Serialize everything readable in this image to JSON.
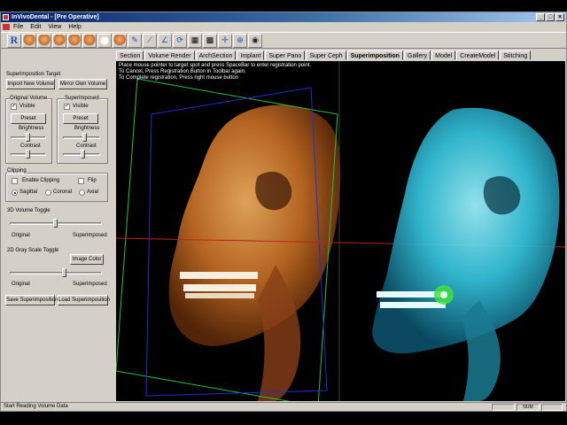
{
  "window": {
    "title": "InVivoDental - [Pre Operative]",
    "controls": {
      "minimize": "_",
      "maximize": "□",
      "close": "×"
    }
  },
  "menu": [
    "File",
    "Edit",
    "View",
    "Help"
  ],
  "toolbar": {
    "r_label": "R"
  },
  "left_panel": {
    "superimposition_target_label": "Superimposition Target",
    "import_new_volume": "Import New Volume",
    "mirror_own_volume": "Mirror Own Volume",
    "original_volume": {
      "label": "Original Volume",
      "visible_label": "Visible",
      "visible_checked": true,
      "preset": "Preset",
      "brightness": "Brightness",
      "contrast": "Contrast"
    },
    "superimposed": {
      "label": "Superimposed",
      "visible_label": "Visible",
      "visible_checked": true,
      "preset": "Preset",
      "brightness": "Brightness",
      "contrast": "Contrast"
    },
    "clipping": {
      "label": "Clipping",
      "enable_clipping": "Enable Clipping",
      "flip": "Flip",
      "sagittal": "Sagittal",
      "coronal": "Coronal",
      "axial": "Axial",
      "selected_plane": "Sagittal"
    },
    "volume_toggle": {
      "label": "3D Volume Toggle",
      "left": "Original",
      "right": "Superimposed"
    },
    "gray_toggle": {
      "label": "2D Gray Scale Toggle",
      "image_color": "Image Color",
      "left": "Original",
      "right": "Superimposed"
    },
    "save_superimposition": "Save Superimposition",
    "load_superimposition": "Load Superimposition"
  },
  "tabs": [
    "Section",
    "Volume Render",
    "ArchSection",
    "Implant",
    "Super Pano",
    "Super Ceph",
    "Superimposition",
    "Gallery",
    "Model",
    "CreateModel",
    "Stitching"
  ],
  "active_tab": "Superimposition",
  "viewport": {
    "instructions": [
      "Place mouse pointer to target spot and press SpaceBar to enter registration point.",
      "To Cancel, Press Registration Button in Toolbar again.",
      "To Complete registration, Press right mouse button"
    ]
  },
  "status": {
    "text": "Start Reading Volume Data",
    "num": "NUM"
  },
  "colors": {
    "titlebar": "#0a246a",
    "original_render": "#d2883c",
    "superimposed_render": "#38c8e0",
    "registration_point": "#40e040"
  }
}
